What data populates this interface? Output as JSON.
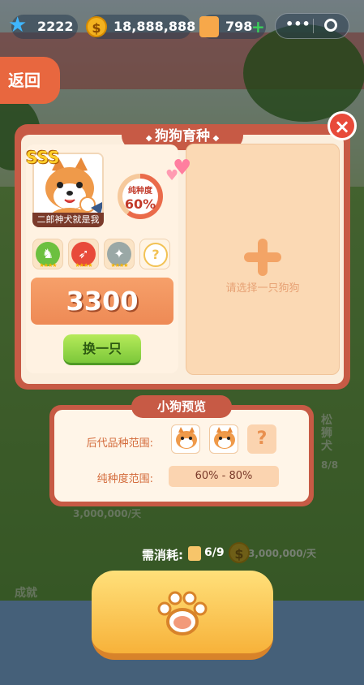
{
  "topbar": {
    "gems": "2222",
    "coins": "18,888,888",
    "food": "798",
    "coin_symbol": "$",
    "add_symbol": "+"
  },
  "back_label": "返回",
  "panel": {
    "title": "狗狗育种",
    "close_symbol": "×",
    "dog": {
      "grade": "SSS",
      "name": "二郎神犬就是我",
      "purity_label": "纯种度",
      "purity_value": "60%",
      "purity_fraction": 0.6
    },
    "skills": [
      {
        "name": "skill-1",
        "color": "#6cc040",
        "stars": "★★★★"
      },
      {
        "name": "skill-2",
        "color": "#e84a3a",
        "stars": "★★★★"
      },
      {
        "name": "skill-3",
        "color": "#9aa8a6",
        "stars": "★★★★"
      },
      {
        "name": "skill-unknown",
        "symbol": "?"
      }
    ],
    "price": "3300",
    "swap_label": "换一只",
    "slot_plus": "+",
    "slot_hint": "请选择一只狗狗"
  },
  "preview": {
    "title": "小狗预览",
    "breed_range_label": "后代品种范围:",
    "unknown_symbol": "?",
    "purity_range_label": "纯种度范围:",
    "purity_range_value": "60% - 80%"
  },
  "cost": {
    "label": "需消耗:",
    "value": "6/9"
  },
  "background": {
    "left_label": "成就",
    "right_label": "松狮犬",
    "right_count": "8/8",
    "income_1": "3,000,000/天",
    "income_2": "3,000,000/天"
  }
}
